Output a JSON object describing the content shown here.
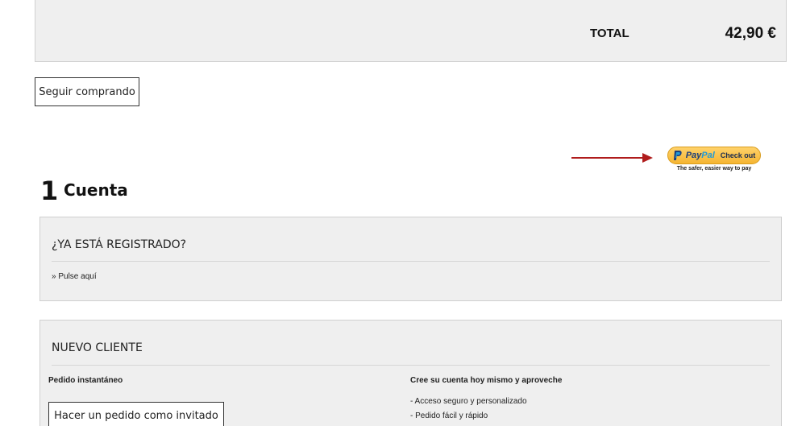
{
  "cart": {
    "total_label": "TOTAL",
    "total_value": "42,90 €"
  },
  "actions": {
    "continue_shopping": "Seguir comprando"
  },
  "paypal": {
    "pay": "Pay",
    "pal": "Pal",
    "checkout": "Check out",
    "tagline": "The safer, easier way to pay",
    "colors": {
      "button": "#f5b532",
      "pay": "#1a3d7c",
      "pal": "#229ad6"
    }
  },
  "annotation": {
    "arrow_color": "#b01c1c"
  },
  "step": {
    "number": "1",
    "title": "Cuenta"
  },
  "registered": {
    "heading": "¿YA ESTÁ REGISTRADO?",
    "link": "» Pulse aquí"
  },
  "new_customer": {
    "heading": "NUEVO CLIENTE",
    "left_title": "Pedido instantáneo",
    "guest_button": "Hacer un pedido como invitado",
    "right_title": "Cree su cuenta hoy mismo y aproveche",
    "benefits": [
      "- Acceso seguro y personalizado",
      "- Pedido fácil y rápido"
    ]
  }
}
